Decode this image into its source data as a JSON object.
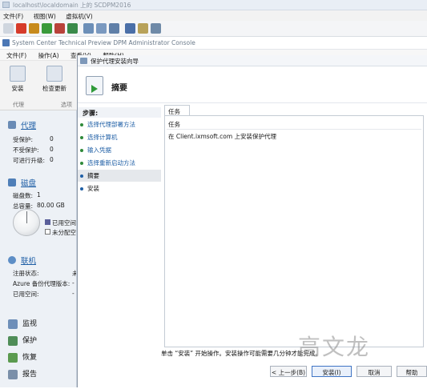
{
  "vm_window": {
    "title": "localhost\\localdomain 上的 SCDPM2016",
    "menu": [
      "文件(F)",
      "视图(W)",
      "虚拟机(V)"
    ]
  },
  "console": {
    "title": "System Center Technical Preview DPM Administrator Console",
    "menu": [
      "文件(F)",
      "操作(A)",
      "查看(V)",
      "帮助(H)"
    ]
  },
  "ribbon": {
    "install_label": "安装",
    "check_update_label": "检查更新",
    "group1": "代理",
    "group2": "选项"
  },
  "leftnav": {
    "agents": {
      "title": "代理",
      "rows": [
        {
          "label": "受保护:",
          "value": "0"
        },
        {
          "label": "不受保护:",
          "value": "0"
        },
        {
          "label": "可进行升级:",
          "value": "0"
        }
      ]
    },
    "disks": {
      "title": "磁盘",
      "count_label": "磁盘数:",
      "count_value": "1",
      "capacity_label": "总容量:",
      "capacity_value": "80.00 GB",
      "legend_used": "已用空间",
      "legend_unalloc": "未分配空"
    },
    "online": {
      "title": "联机",
      "rows": [
        {
          "label": "注册状态:",
          "value": "未"
        },
        {
          "label": "Azure 备份代理版本:",
          "value": "-"
        },
        {
          "label": "已用空间:",
          "value": "-"
        }
      ]
    },
    "nav": [
      {
        "label": "监视",
        "icon": "monitor-icon"
      },
      {
        "label": "保护",
        "icon": "protection-icon"
      },
      {
        "label": "恢复",
        "icon": "recovery-icon"
      },
      {
        "label": "报告",
        "icon": "reports-icon"
      }
    ]
  },
  "wizard": {
    "title": "保护代理安装向导",
    "heading": "摘要",
    "steps_label": "步骤:",
    "steps": [
      {
        "label": "选择代理部署方法",
        "state": "done"
      },
      {
        "label": "选择计算机",
        "state": "done"
      },
      {
        "label": "输入凭据",
        "state": "done"
      },
      {
        "label": "选择重新启动方法",
        "state": "done"
      },
      {
        "label": "摘要",
        "state": "current"
      },
      {
        "label": "安装",
        "state": "todo"
      }
    ],
    "tab_label": "任务",
    "tasks_header": "任务",
    "task_text": "在 Client.ixmsoft.com 上安装保护代理",
    "status_text": "单击 “安装” 开始操作。安装操作可能需要几分钟才能完成。",
    "buttons": {
      "back": "< 上一步(B)",
      "install": "安装(I)",
      "cancel": "取消",
      "help": "帮助"
    }
  },
  "watermark": "高文龙",
  "colors": {
    "accent": "#1f5fa6",
    "nav_bg": "#edf1f6",
    "done_green": "#2f8a3a"
  }
}
